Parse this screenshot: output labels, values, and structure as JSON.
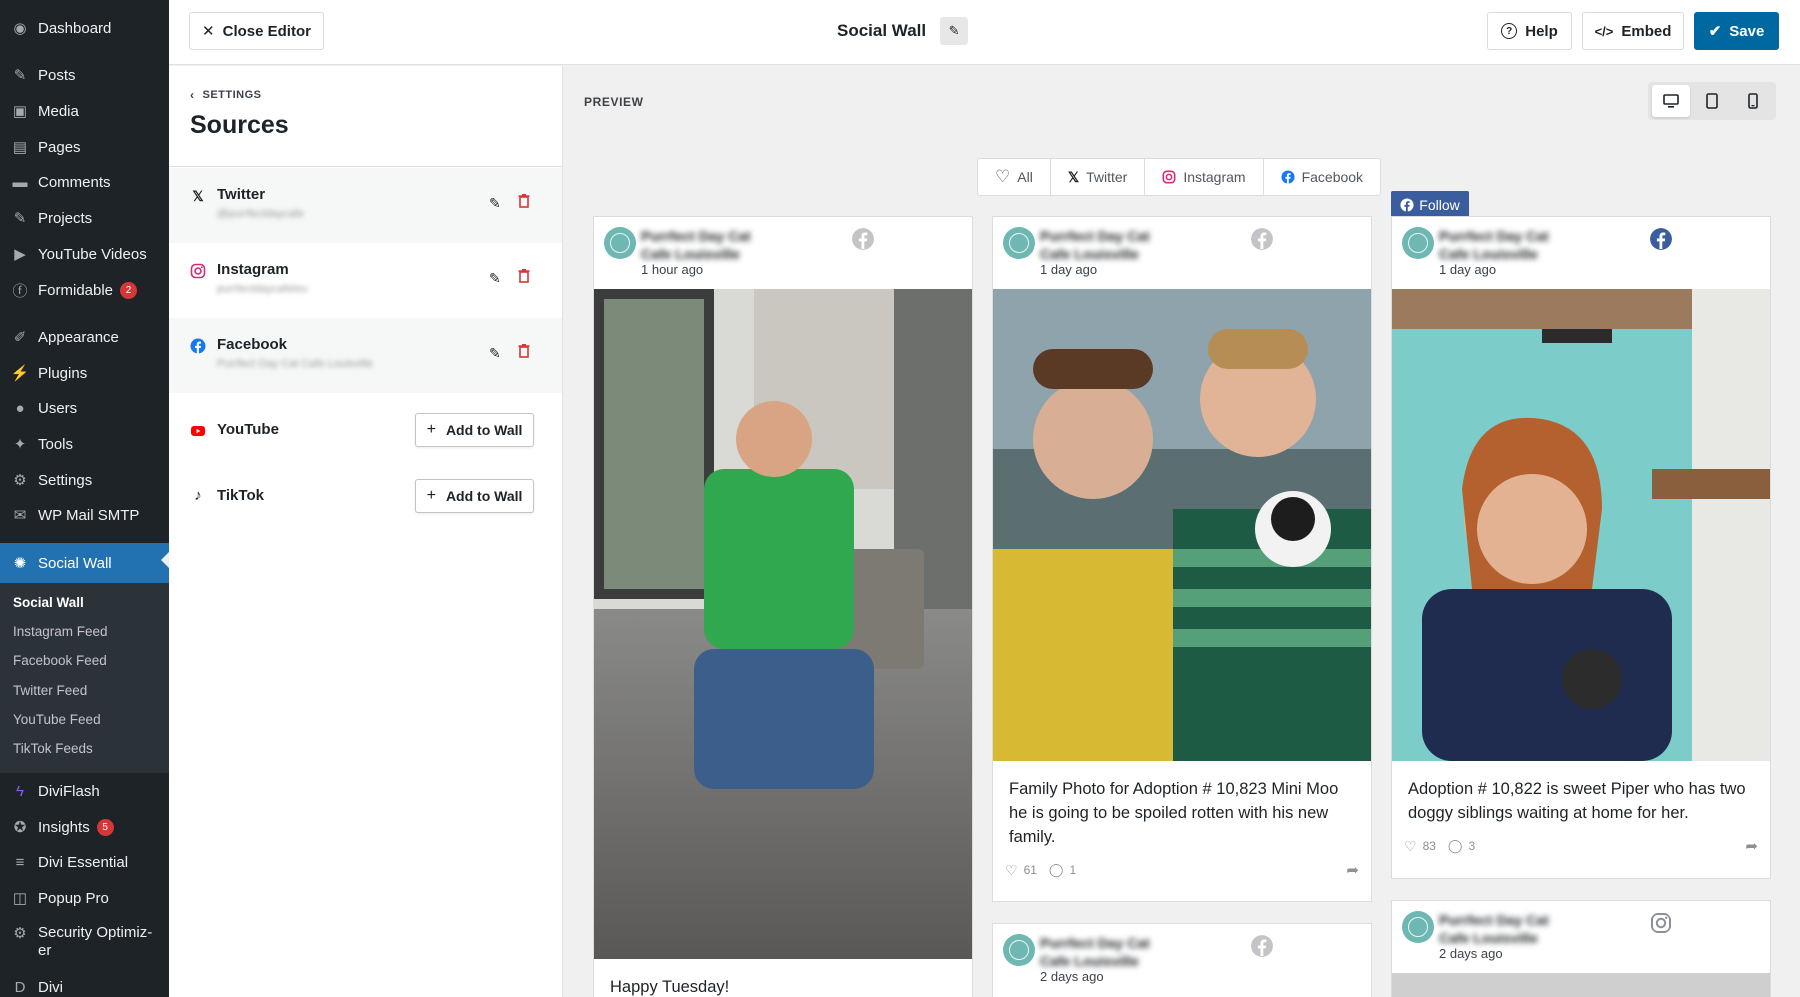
{
  "admin_menu": {
    "items": [
      {
        "label": "Dashboard",
        "icon": "dashboard-icon",
        "glyph": "◉"
      },
      {
        "label": "Posts",
        "icon": "pin-icon",
        "glyph": "✎"
      },
      {
        "label": "Media",
        "icon": "media-icon",
        "glyph": "▣"
      },
      {
        "label": "Pages",
        "icon": "pages-icon",
        "glyph": "▤"
      },
      {
        "label": "Comments",
        "icon": "comments-icon",
        "glyph": "▬"
      },
      {
        "label": "Projects",
        "icon": "pin-icon",
        "glyph": "✎"
      },
      {
        "label": "YouTube Videos",
        "icon": "video-icon",
        "glyph": "▶"
      },
      {
        "label": "Formidable",
        "icon": "formidable-icon",
        "glyph": "ⓕ",
        "badge": "2"
      },
      {
        "label": "Appearance",
        "icon": "brush-icon",
        "glyph": "✐"
      },
      {
        "label": "Plugins",
        "icon": "plugin-icon",
        "glyph": "⚡"
      },
      {
        "label": "Users",
        "icon": "user-icon",
        "glyph": "●"
      },
      {
        "label": "Tools",
        "icon": "wrench-icon",
        "glyph": "✦"
      },
      {
        "label": "Settings",
        "icon": "settings-icon",
        "glyph": "⚙"
      },
      {
        "label": "WP Mail SMTP",
        "icon": "mail-icon",
        "glyph": "✉"
      },
      {
        "label": "Social Wall",
        "icon": "social-wall-icon",
        "glyph": "✺"
      },
      {
        "label": "DiviFlash",
        "icon": "diviflash-icon",
        "glyph": "ϟ"
      },
      {
        "label": "Insights",
        "icon": "insights-icon",
        "glyph": "✪",
        "badge": "5"
      },
      {
        "label": "Divi Essential",
        "icon": "divi-essential-icon",
        "glyph": "≡"
      },
      {
        "label": "Popup Pro",
        "icon": "popup-icon",
        "glyph": "◫"
      },
      {
        "label": "Security Optimiz-er",
        "icon": "shield-icon",
        "glyph": "⚙"
      },
      {
        "label": "Divi",
        "icon": "divi-icon",
        "glyph": "D"
      }
    ],
    "submenu": [
      "Social Wall",
      "Instagram Feed",
      "Facebook Feed",
      "Twitter Feed",
      "YouTube Feed",
      "TikTok Feeds"
    ]
  },
  "topbar": {
    "close_label": "Close Editor",
    "title": "Social Wall",
    "help_label": "Help",
    "embed_label": "Embed",
    "save_label": "Save"
  },
  "panel": {
    "back_label": "SETTINGS",
    "title": "Sources",
    "sources": [
      {
        "name": "Twitter",
        "handle": "@purrfectdaycafe",
        "connected": true
      },
      {
        "name": "Instagram",
        "handle": "purrfectdaycafelou",
        "connected": true
      },
      {
        "name": "Facebook",
        "handle": "Purrfect Day Cat Cafe Louisville",
        "connected": true
      },
      {
        "name": "YouTube",
        "action": "Add to Wall",
        "connected": false
      },
      {
        "name": "TikTok",
        "action": "Add to Wall",
        "connected": false
      }
    ]
  },
  "preview": {
    "label": "PREVIEW",
    "filters": [
      "All",
      "Twitter",
      "Instagram",
      "Facebook"
    ],
    "follow_label": "Follow",
    "posts": [
      {
        "author": "Purrfect Day Cat Cafe Louisville",
        "time": "1 hour ago",
        "network": "facebook",
        "text": "Happy Tuesday!"
      },
      {
        "author": "Purrfect Day Cat Cafe Louisville",
        "time": "1 day ago",
        "network": "facebook",
        "text": "Family Photo for Adoption # 10,823 Mini Moo he is going to be spoiled rotten with his new family.",
        "likes": "61",
        "comments": "1"
      },
      {
        "author": "Purrfect Day Cat Cafe Louisville",
        "time": "2 days ago",
        "network": "facebook"
      },
      {
        "author": "Purrfect Day Cat Cafe Louisville",
        "time": "1 day ago",
        "network": "facebook",
        "text": "Adoption # 10,822 is sweet Piper who has two doggy siblings waiting at home for her.",
        "likes": "83",
        "comments": "3"
      },
      {
        "author": "Purrfect Day Cat Cafe Louisville",
        "time": "2 days ago",
        "network": "instagram"
      }
    ]
  },
  "colors": {
    "wp_dark": "#1d2327",
    "wp_blue": "#2271b1",
    "save_blue": "#0068a0",
    "facebook_blue": "#1877f2",
    "follow_blue": "#395d9d",
    "delete_red": "#d63638",
    "youtube_red": "#ff0000",
    "instagram_pink": "#d62976"
  }
}
